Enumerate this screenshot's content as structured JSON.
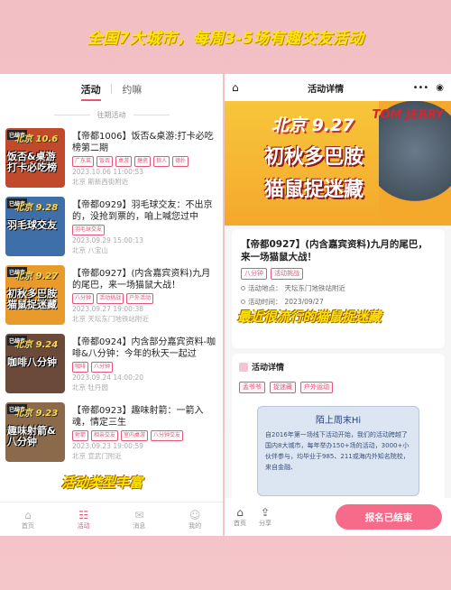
{
  "banner": {
    "text": "全国7大城市，每周3-5场有趣交友活动"
  },
  "left": {
    "tabs": [
      {
        "label": "活动",
        "active": true
      },
      {
        "label": "约嘛",
        "active": false
      }
    ],
    "section_label": "往期活动",
    "overlay_text": "活动类型丰富",
    "events": [
      {
        "thumb_city": "北京 10.6",
        "thumb_title": "饭否&桌游打卡必吃榜",
        "thumb_color": "#c04a2b",
        "title": "【帝都1006】饭否&桌游:打卡必吃榜第二期",
        "tags": [
          "广东菜",
          "饭否",
          "桌游",
          "搪瓷",
          "狼人",
          "德扑"
        ],
        "time": "2023.10.06 11:00:53",
        "location": "北京 斯新西街附近"
      },
      {
        "thumb_city": "北京 9.28",
        "thumb_title": "羽毛球交友",
        "thumb_color": "#3f6fa8",
        "title": "【帝都0929】羽毛球交友：不出京的，没抢到票的，咱上喊您过中",
        "tags": [
          "羽毛球交友"
        ],
        "time": "2023.09.29 15:00:13",
        "location": "北京 八宝山"
      },
      {
        "thumb_city": "北京 9.27",
        "thumb_title": "初秋多巴胺猫鼠捉迷藏",
        "thumb_color": "#e89a2a",
        "title": "【帝都0927】(内含嘉宾资料)九月的尾巴，来一场猫鼠大战！",
        "tags": [
          "八分钟",
          "活动挑战",
          "户外活动"
        ],
        "time": "2023.09.27 19:00:38",
        "location": "北京 天坛东门地铁站附近"
      },
      {
        "thumb_city": "北京 9.24",
        "thumb_title": "咖啡八分钟",
        "thumb_color": "#6b4a3a",
        "title": "【帝都0924】内含部分嘉宾资料-咖啡&八分钟：今年的秋天一起过",
        "tags": [
          "咖啡",
          "八分钟"
        ],
        "time": "2023.09.24 14:00:20",
        "location": "北京 牡丹园"
      },
      {
        "thumb_city": "北京 9.23",
        "thumb_title": "趣味射箭&八分钟",
        "thumb_color": "#8a6a4a",
        "title": "【帝都0923】趣味射箭：一箭入魂，情定三生",
        "tags": [
          "射箭",
          "相亲交友",
          "室内桌游",
          "八分钟交友"
        ],
        "time": "2023.09.23 19:00:59",
        "location": "北京 宣武门附近"
      }
    ],
    "nav": [
      {
        "label": "首页",
        "icon": "home-icon",
        "active": false
      },
      {
        "label": "活动",
        "icon": "activity-icon",
        "active": true
      },
      {
        "label": "消息",
        "icon": "message-icon",
        "active": false
      },
      {
        "label": "我的",
        "icon": "profile-icon",
        "active": false
      }
    ]
  },
  "right": {
    "header_title": "活动详情",
    "hero": {
      "line1": "北京  9.27",
      "line2": "初秋多巴胺",
      "line3": "猫鼠捉迷藏",
      "logo": "TOM JERRY"
    },
    "info": {
      "title": "【帝都0927】(内含嘉宾资料)九月的尾巴，来一场猫鼠大战！",
      "tags": [
        "八分钟",
        "活动挑战"
      ],
      "location_label": "活动地点：",
      "location": "天坛东门地铁站附近",
      "time_label": "活动时间：",
      "time": "2023/09/27"
    },
    "overlay_text": "最近很流行的猫鼠捉迷藏",
    "detail": {
      "heading": "活动详情",
      "tags": [
        "孟爷爷",
        "捉迷藏",
        "户外运动"
      ],
      "promo_title": "陌上周末Hi",
      "promo_text": "自2016年第一场线下活动开始，我们的活动跨越了国内8大城市，每年举办150+场的活动，3000+小伙伴参与，均毕业于985、211或海内外知名院校，来自金融、"
    },
    "nav": [
      {
        "label": "首页",
        "icon": "home-icon"
      },
      {
        "label": "分享",
        "icon": "share-icon"
      }
    ],
    "signup_button": "报名已结束"
  },
  "colors": {
    "accent": "#e75478",
    "button": "#f76b8a",
    "banner_text": "#ffe600",
    "background": "#f2bfc4"
  }
}
